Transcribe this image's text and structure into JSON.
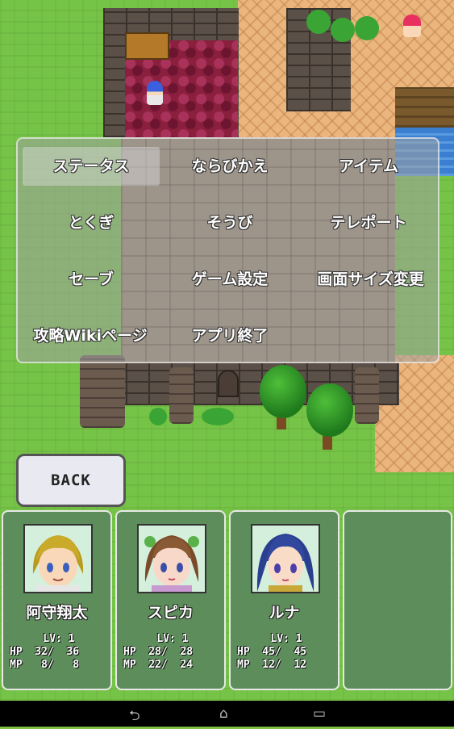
{
  "menu": {
    "items": [
      {
        "label": "ステータス",
        "selected": true
      },
      {
        "label": "ならびかえ"
      },
      {
        "label": "アイテム"
      },
      {
        "label": "とくぎ"
      },
      {
        "label": "そうび"
      },
      {
        "label": "テレポート"
      },
      {
        "label": "セーブ"
      },
      {
        "label": "ゲーム設定"
      },
      {
        "label": "画面サイズ変更"
      },
      {
        "label": "攻略Wikiページ"
      },
      {
        "label": "アプリ終了"
      }
    ]
  },
  "back_button": {
    "label": "BACK"
  },
  "party": [
    {
      "name": "阿守翔太",
      "lv": "LV: 1",
      "hp": "HP  32/  36",
      "mp": "MP   8/   8",
      "hair": "#b99a1c",
      "skin": "#f8d8b8",
      "eyes": "#3a5fbf"
    },
    {
      "name": "スピカ",
      "lv": "LV: 1",
      "hp": "HP  28/  28",
      "mp": "MP  22/  24",
      "hair": "#7a4a2a",
      "skin": "#f8d8c8",
      "eyes": "#3a4fa8"
    },
    {
      "name": "ルナ",
      "lv": "LV: 1",
      "hp": "HP  45/  45",
      "mp": "MP  12/  12",
      "hair": "#2a3f8f",
      "skin": "#f8dcc8",
      "eyes": "#4a3fa8"
    }
  ],
  "navbar": {
    "back_icon": "⮌",
    "home_icon": "⌂",
    "recents_icon": "▭"
  }
}
